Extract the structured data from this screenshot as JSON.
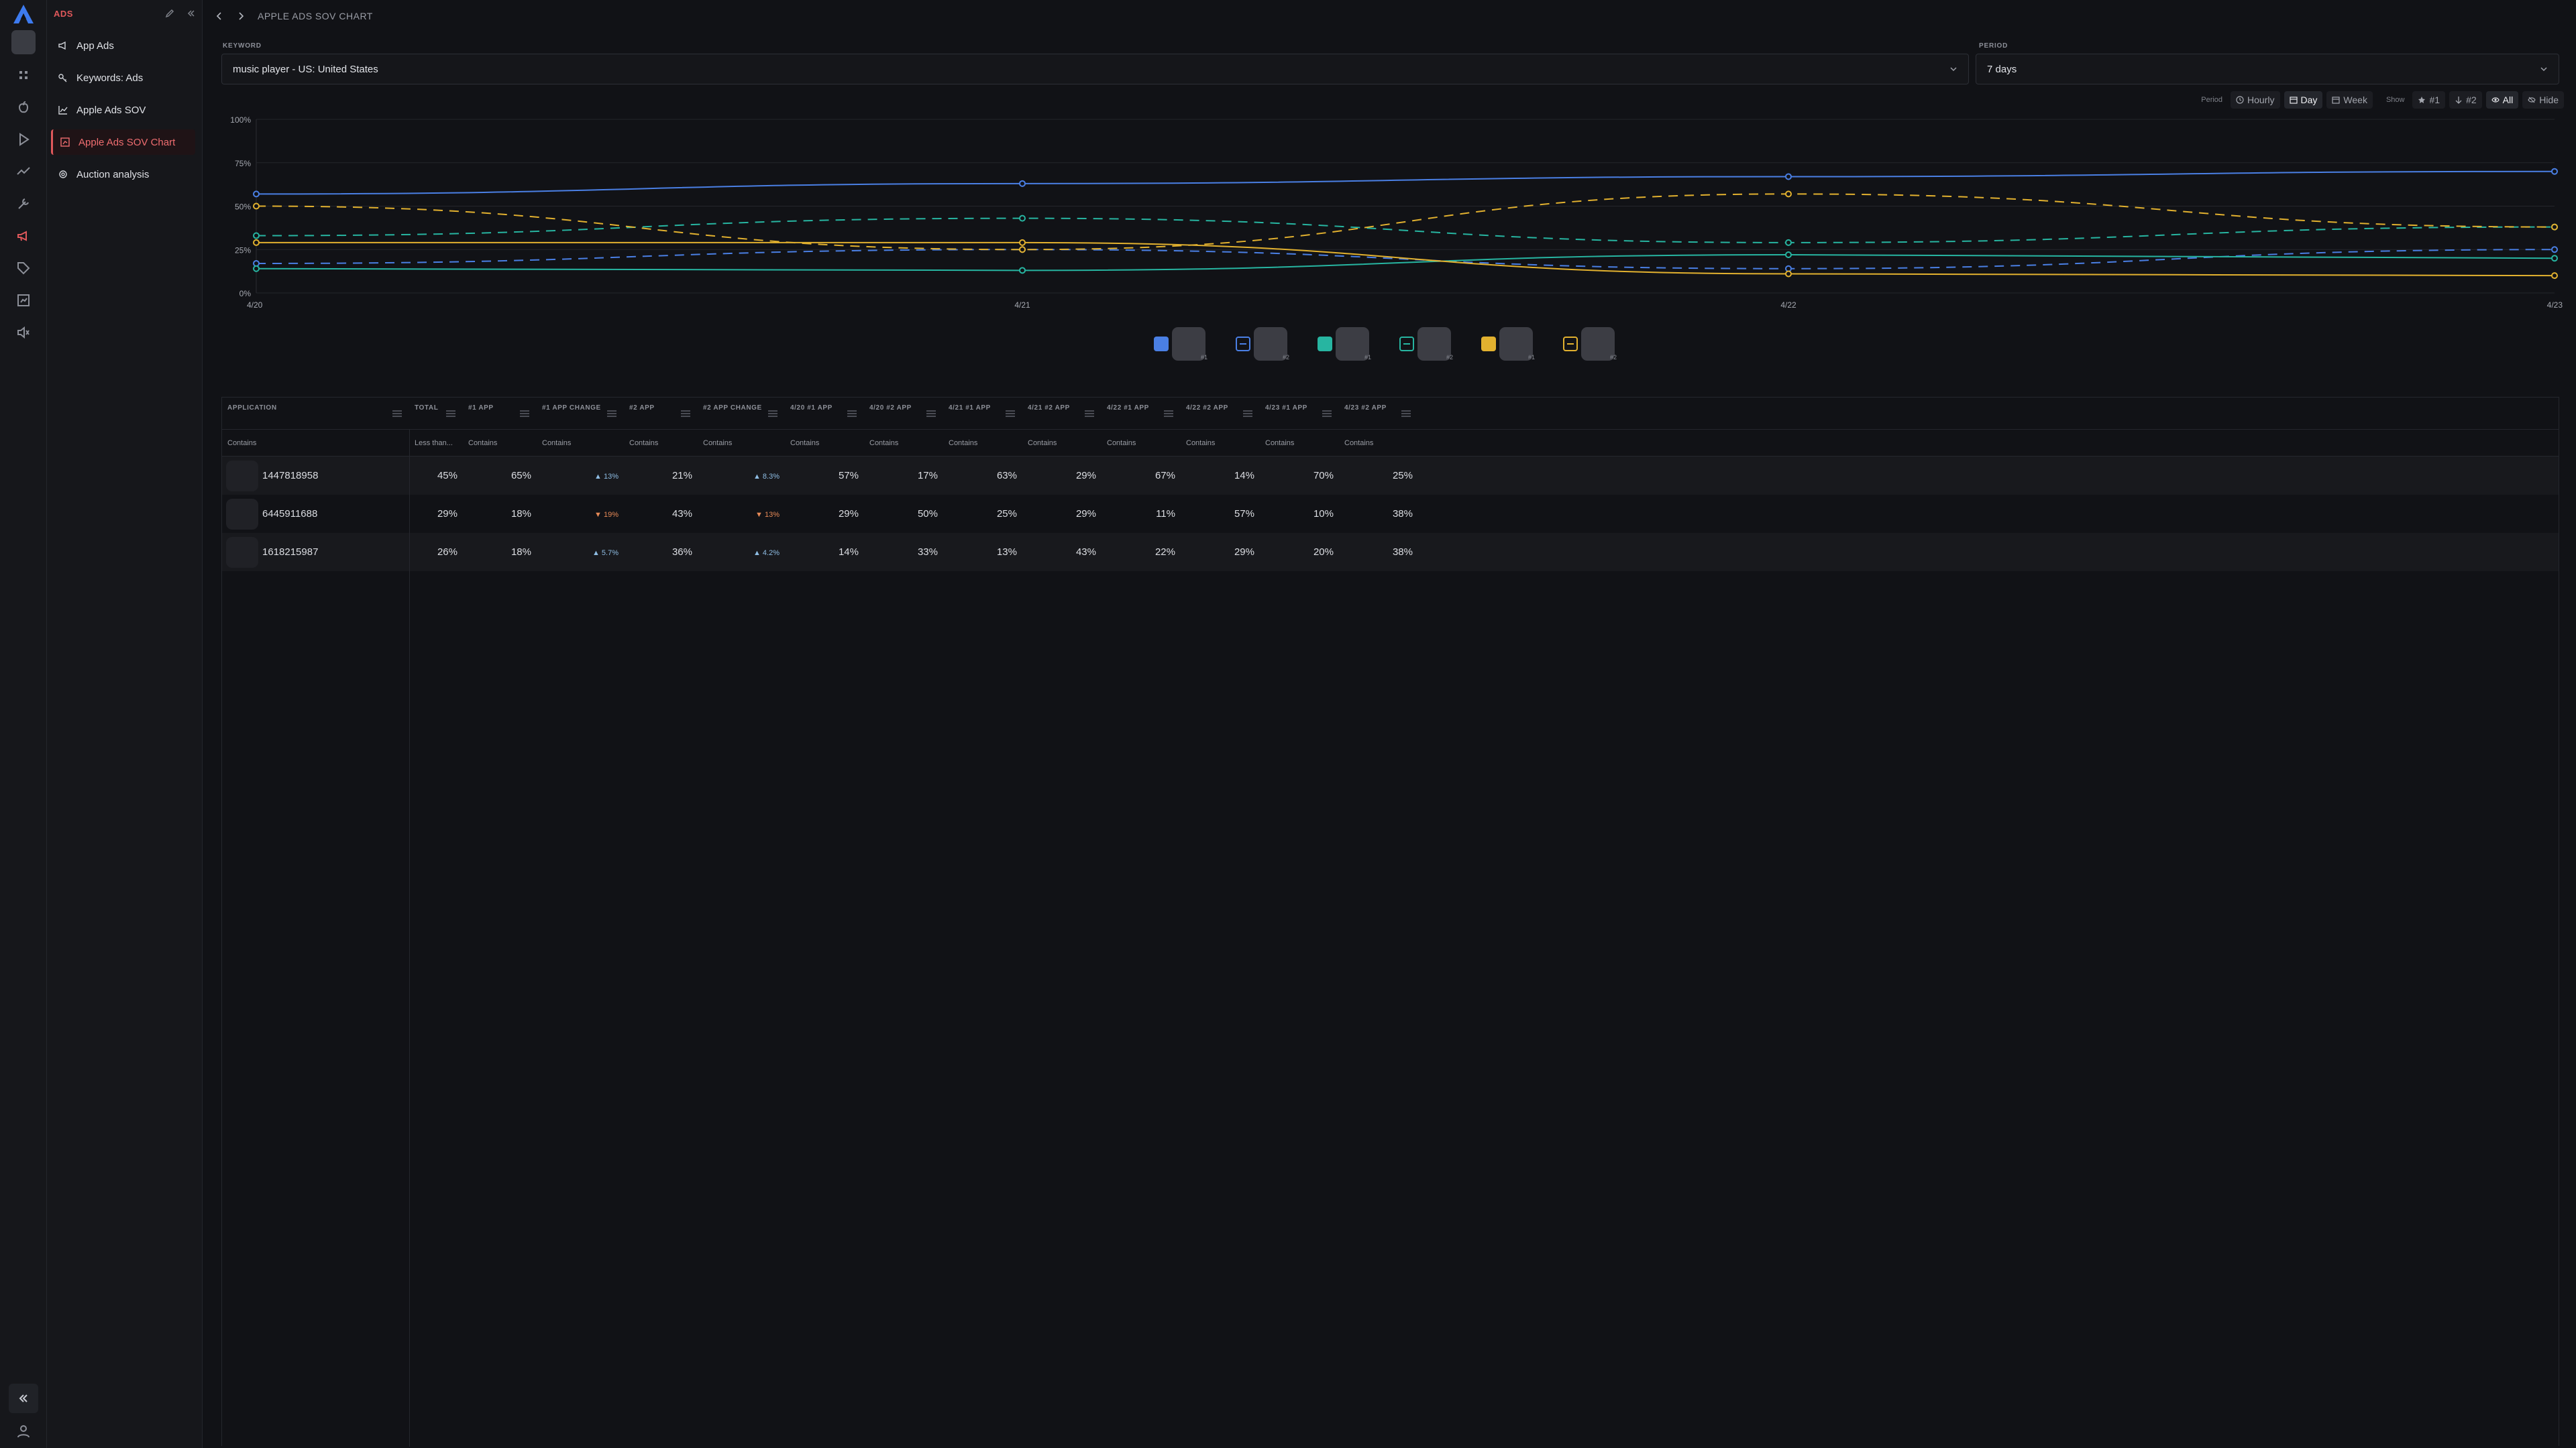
{
  "rail": {
    "icons": [
      "logo-icon",
      "app-switcher",
      "grid-icon",
      "apple-icon",
      "play-icon",
      "trend-icon",
      "tools-icon",
      "megaphone-icon",
      "tag-icon",
      "chart-box-icon",
      "speaker-icon"
    ]
  },
  "sidebar": {
    "section_title": "ADS",
    "items": [
      {
        "label": "App Ads",
        "icon": "megaphone-icon"
      },
      {
        "label": "Keywords: Ads",
        "icon": "key-icon"
      },
      {
        "label": "Apple Ads SOV",
        "icon": "line-chart-icon"
      },
      {
        "label": "Apple Ads SOV Chart",
        "icon": "chart-icon",
        "active": true
      },
      {
        "label": "Auction analysis",
        "icon": "gear-cog-icon"
      }
    ]
  },
  "header": {
    "breadcrumb": "APPLE ADS SOV CHART"
  },
  "filters": {
    "keyword_label": "KEYWORD",
    "keyword_value": "music player - US: United States",
    "period_label": "PERIOD",
    "period_value": "7 days"
  },
  "controls": {
    "period_label": "Period",
    "hourly": "Hourly",
    "day": "Day",
    "week": "Week",
    "show_label": "Show",
    "rank1": "#1",
    "rank2": "#2",
    "all": "All",
    "hide": "Hide"
  },
  "chart_data": {
    "type": "line",
    "x": [
      "4/20",
      "4/21",
      "4/22",
      "4/23"
    ],
    "y_ticks": [
      "100%",
      "75%",
      "50%",
      "25%",
      "0%"
    ],
    "ylim": [
      0,
      100
    ],
    "grid": true,
    "colors": {
      "blue": "#4a7fe4",
      "teal": "#27b5a1",
      "yellow": "#e2b12f"
    },
    "series": [
      {
        "color": "#4a7fe4",
        "dash": false,
        "values": [
          57,
          63,
          67,
          70
        ]
      },
      {
        "color": "#4a7fe4",
        "dash": true,
        "values": [
          17,
          25,
          14,
          25
        ]
      },
      {
        "color": "#27b5a1",
        "dash": false,
        "values": [
          14,
          13,
          22,
          20
        ]
      },
      {
        "color": "#27b5a1",
        "dash": true,
        "values": [
          33,
          43,
          29,
          38
        ]
      },
      {
        "color": "#e2b12f",
        "dash": false,
        "values": [
          29,
          29,
          11,
          10
        ]
      },
      {
        "color": "#e2b12f",
        "dash": true,
        "values": [
          50,
          25,
          57,
          38
        ]
      }
    ]
  },
  "legend": [
    {
      "color": "#4a7fe4",
      "style": "solid",
      "rank": "#1"
    },
    {
      "color": "#4a7fe4",
      "style": "outline",
      "rank": "#2"
    },
    {
      "color": "#27b5a1",
      "style": "solid",
      "rank": "#1"
    },
    {
      "color": "#27b5a1",
      "style": "outline",
      "rank": "#2"
    },
    {
      "color": "#e2b12f",
      "style": "solid",
      "rank": "#1"
    },
    {
      "color": "#e2b12f",
      "style": "outline",
      "rank": "#2"
    }
  ],
  "table": {
    "columns": [
      {
        "label": "APPLICATION",
        "filter": "Contains"
      },
      {
        "label": "TOTAL",
        "filter": "Less than..."
      },
      {
        "label": "#1 APP",
        "filter": "Contains"
      },
      {
        "label": "#1 APP CHANGE",
        "filter": "Contains"
      },
      {
        "label": "#2 APP",
        "filter": "Contains"
      },
      {
        "label": "#2 APP CHANGE",
        "filter": "Contains"
      },
      {
        "label": "4/20 #1 APP",
        "filter": "Contains"
      },
      {
        "label": "4/20 #2 APP",
        "filter": "Contains"
      },
      {
        "label": "4/21 #1 APP",
        "filter": "Contains"
      },
      {
        "label": "4/21 #2 APP",
        "filter": "Contains"
      },
      {
        "label": "4/22 #1 APP",
        "filter": "Contains"
      },
      {
        "label": "4/22 #2 APP",
        "filter": "Contains"
      },
      {
        "label": "4/23 #1 APP",
        "filter": "Contains"
      },
      {
        "label": "4/23 #2 APP",
        "filter": "Contains"
      }
    ],
    "rows": [
      [
        "1447818958",
        "45%",
        "65%",
        "▲ 13%",
        "21%",
        "▲ 8.3%",
        "57%",
        "17%",
        "63%",
        "29%",
        "67%",
        "14%",
        "70%",
        "25%"
      ],
      [
        "6445911688",
        "29%",
        "18%",
        "▼ 19%",
        "43%",
        "▼ 13%",
        "29%",
        "50%",
        "25%",
        "29%",
        "11%",
        "57%",
        "10%",
        "38%"
      ],
      [
        "1618215987",
        "26%",
        "18%",
        "▲ 5.7%",
        "36%",
        "▲ 4.2%",
        "14%",
        "33%",
        "13%",
        "43%",
        "22%",
        "29%",
        "20%",
        "38%"
      ]
    ],
    "change_dirs": [
      [
        "up",
        "up"
      ],
      [
        "down",
        "down"
      ],
      [
        "up",
        "up"
      ]
    ]
  }
}
